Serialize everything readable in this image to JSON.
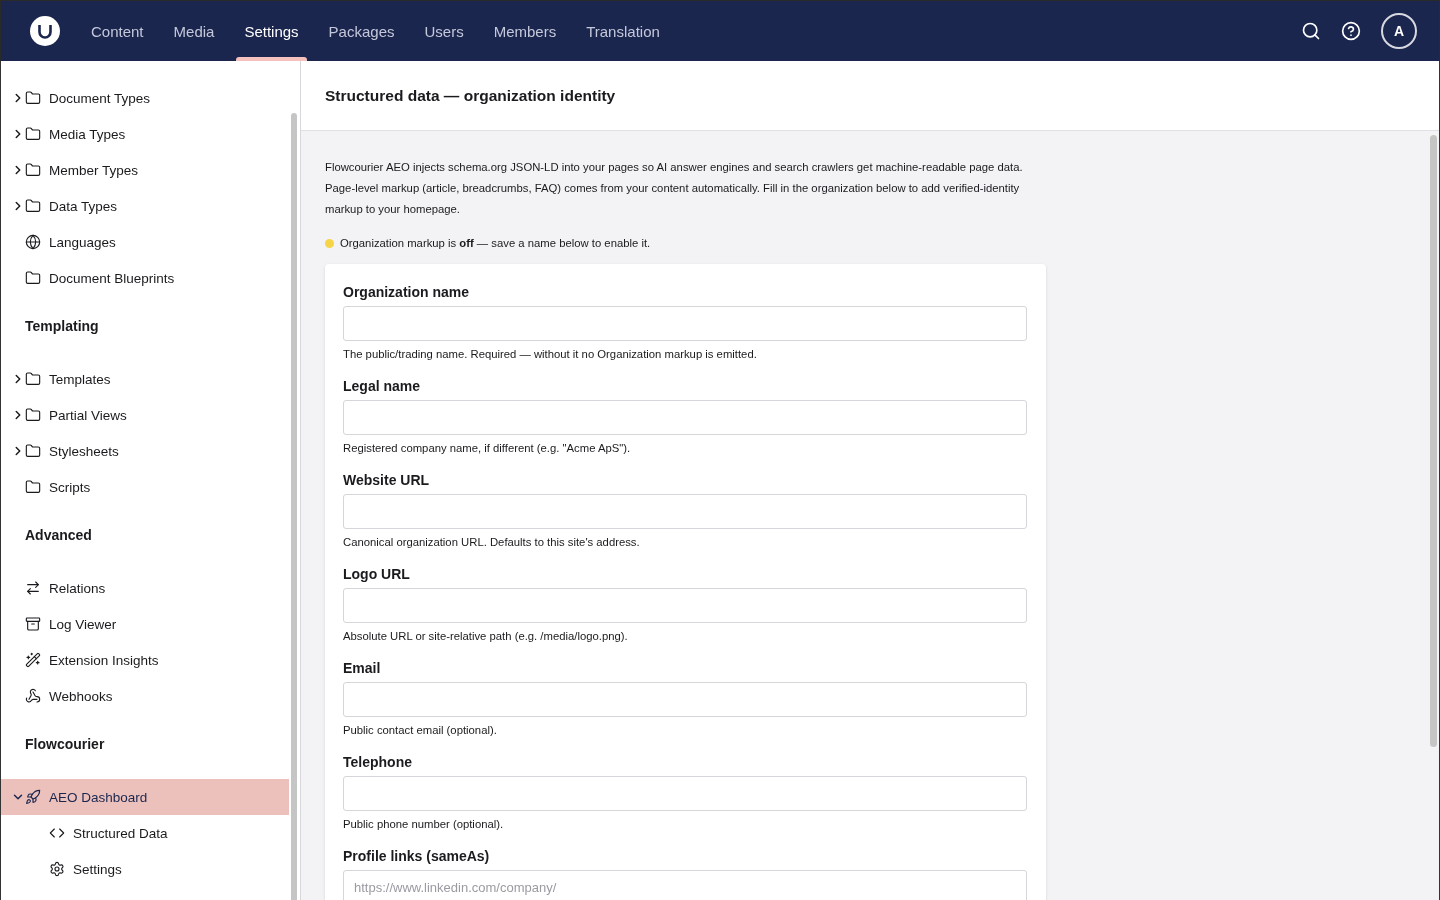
{
  "header": {
    "tabs": [
      {
        "label": "Content",
        "selected": false
      },
      {
        "label": "Media",
        "selected": false
      },
      {
        "label": "Settings",
        "selected": true
      },
      {
        "label": "Packages",
        "selected": false
      },
      {
        "label": "Users",
        "selected": false
      },
      {
        "label": "Members",
        "selected": false
      },
      {
        "label": "Translation",
        "selected": false
      }
    ],
    "avatar": "A"
  },
  "sidebar": {
    "sections": [
      {
        "items": [
          {
            "label": "Document Types",
            "kind": "folder",
            "expanded": false,
            "selected": false
          },
          {
            "label": "Media Types",
            "kind": "folder",
            "expanded": false,
            "selected": false
          },
          {
            "label": "Member Types",
            "kind": "folder",
            "expanded": false,
            "selected": false
          },
          {
            "label": "Data Types",
            "kind": "folder",
            "expanded": false,
            "selected": false
          },
          {
            "label": "Languages",
            "kind": "globe",
            "selected": false
          },
          {
            "label": "Document Blueprints",
            "kind": "folder",
            "selected": false
          }
        ]
      },
      {
        "title": "Templating",
        "items": [
          {
            "label": "Templates",
            "kind": "folder",
            "expanded": false,
            "selected": false
          },
          {
            "label": "Partial Views",
            "kind": "folder",
            "expanded": false,
            "selected": false
          },
          {
            "label": "Stylesheets",
            "kind": "folder",
            "expanded": false,
            "selected": false
          },
          {
            "label": "Scripts",
            "kind": "folder",
            "selected": false
          }
        ]
      },
      {
        "title": "Advanced",
        "items": [
          {
            "label": "Relations",
            "kind": "arrows",
            "selected": false
          },
          {
            "label": "Log Viewer",
            "kind": "archive",
            "selected": false
          },
          {
            "label": "Extension Insights",
            "kind": "wand",
            "selected": false
          },
          {
            "label": "Webhooks",
            "kind": "webhook",
            "selected": false
          }
        ]
      },
      {
        "title": "Flowcourier",
        "items": [
          {
            "label": "AEO Dashboard",
            "kind": "rocket",
            "expanded": true,
            "selected": true,
            "children": [
              {
                "label": "Structured Data",
                "kind": "code",
                "selected": false
              },
              {
                "label": "Settings",
                "kind": "gear",
                "selected": false
              }
            ]
          }
        ]
      }
    ]
  },
  "main": {
    "title": "Structured data — organization identity",
    "description": "Flowcourier AEO injects schema.org JSON-LD into your pages so AI answer engines and search crawlers get machine-readable page data. Page-level markup (article, breadcrumbs, FAQ) comes from your content automatically. Fill in the organization below to add verified-identity markup to your homepage.",
    "status": {
      "on": false,
      "text": "Organization markup is **off** — save a name below to enable it."
    },
    "fields": [
      {
        "label": "Organization name",
        "hint": "The public/trading name. Required — without it no Organization markup is emitted."
      },
      {
        "label": "Legal name",
        "hint": "Registered company name, if different (e.g. \"Acme ApS\")."
      },
      {
        "label": "Website URL",
        "hint": "Canonical organization URL. Defaults to this site's address."
      },
      {
        "label": "Logo URL",
        "hint": "Absolute URL or site-relative path (e.g. /media/logo.png)."
      },
      {
        "label": "Email",
        "hint": "Public contact email (optional)."
      },
      {
        "label": "Telephone",
        "hint": "Public phone number (optional)."
      },
      {
        "label": "Profile links (sameAs)",
        "placeholder": "https://www.linkedin.com/company/"
      }
    ]
  }
}
